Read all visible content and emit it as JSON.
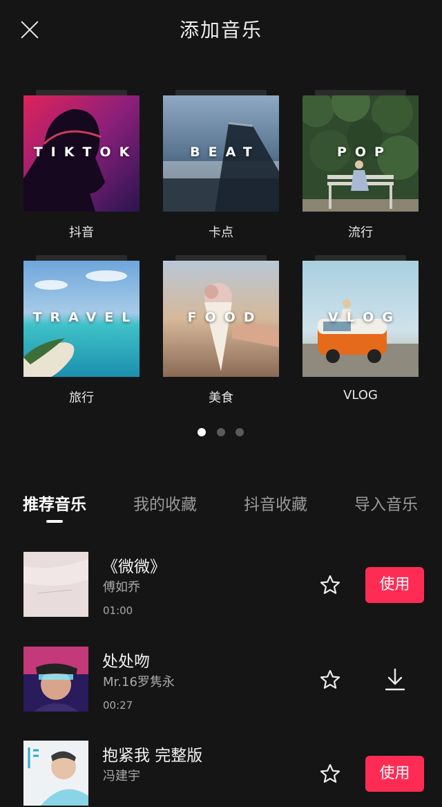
{
  "header": {
    "title": "添加音乐"
  },
  "categories": [
    {
      "thumb_text": "TIKTOK",
      "label": "抖音"
    },
    {
      "thumb_text": "BEAT",
      "label": "卡点"
    },
    {
      "thumb_text": "POP",
      "label": "流行"
    },
    {
      "thumb_text": "TRAVEL",
      "label": "旅行"
    },
    {
      "thumb_text": "FOOD",
      "label": "美食"
    },
    {
      "thumb_text": "VLOG",
      "label": "VLOG"
    }
  ],
  "pagination": {
    "total": 3,
    "active": 1
  },
  "tabs": [
    {
      "label": "推荐音乐",
      "active": true
    },
    {
      "label": "我的收藏"
    },
    {
      "label": "抖音收藏"
    },
    {
      "label": "导入音乐"
    }
  ],
  "songs": [
    {
      "title": "《微微》",
      "artist": "傅如乔",
      "duration": "01:00",
      "action": "使用"
    },
    {
      "title": "处处吻",
      "artist": "Mr.16罗隽永",
      "duration": "00:27",
      "action": "download-icon"
    },
    {
      "title": "抱紧我 完整版",
      "artist": "冯建宇",
      "duration": "",
      "action": "使用"
    }
  ],
  "colors": {
    "background": "#151515",
    "accent": "#fe2c55"
  }
}
